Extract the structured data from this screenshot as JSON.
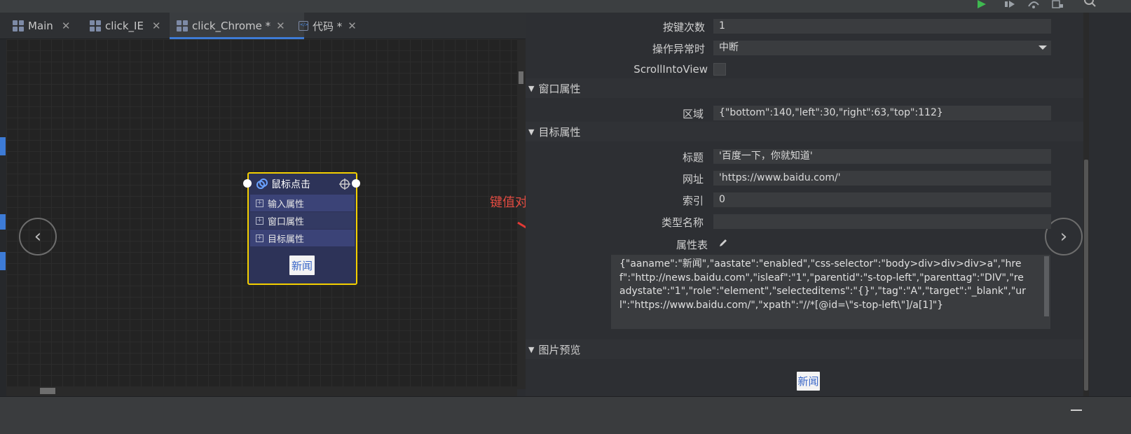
{
  "tabs": [
    {
      "label": "Main",
      "icon": "grid-icon",
      "close": "✕",
      "active": false
    },
    {
      "label": "click_IE",
      "icon": "grid-icon",
      "close": "✕",
      "active": false
    },
    {
      "label": "click_Chrome *",
      "icon": "grid-icon",
      "close": "✕",
      "active": true
    },
    {
      "label": "代码 *",
      "icon": "code-icon",
      "close": "✕",
      "active": false
    }
  ],
  "nav": {
    "prev": "‹",
    "next": "›"
  },
  "activity": {
    "title": "鼠标点击",
    "rows": [
      "输入属性",
      "窗口属性",
      "目标属性"
    ],
    "preview_text": "新闻"
  },
  "annotation": {
    "text": "键值对",
    "color": "#e24b41"
  },
  "panel": {
    "props_top": [
      {
        "label": "按键次数",
        "value": "1"
      },
      {
        "label": "操作异常时",
        "value": "中断",
        "dropdown": true
      },
      {
        "label": "ScrollIntoView",
        "checkbox": true,
        "checked": false
      }
    ],
    "window_section": {
      "title": "窗口属性",
      "props": [
        {
          "label": "区域",
          "value": "{\"bottom\":140,\"left\":30,\"right\":63,\"top\":112}"
        }
      ]
    },
    "target_section": {
      "title": "目标属性",
      "props": [
        {
          "label": "标题",
          "value": "'百度一下，你就知道'"
        },
        {
          "label": "网址",
          "value": "'https://www.baidu.com/'"
        },
        {
          "label": "索引",
          "value": "0"
        },
        {
          "label": "类型名称",
          "value": ""
        },
        {
          "label": "属性表"
        }
      ],
      "attr_json": "{\"aaname\":\"新闻\",\"aastate\":\"enabled\",\"css-selector\":\"body>div>div>div>a\",\"href\":\"http://news.baidu.com\",\"isleaf\":\"1\",\"parentid\":\"s-top-left\",\"parenttag\":\"DIV\",\"readystate\":\"1\",\"role\":\"element\",\"selecteditems\":\"{}\",\"tag\":\"A\",\"target\":\"_blank\",\"url\":\"https://www.baidu.com/\",\"xpath\":\"//*[@id=\\\"s-top-left\\\"]/a[1]\"}"
    },
    "image_section": {
      "title": "图片预览",
      "preview_text": "新闻"
    }
  },
  "colors": {
    "accent": "#3d7bd6",
    "card_border": "#f4d000",
    "run_green": "#3fb950"
  }
}
